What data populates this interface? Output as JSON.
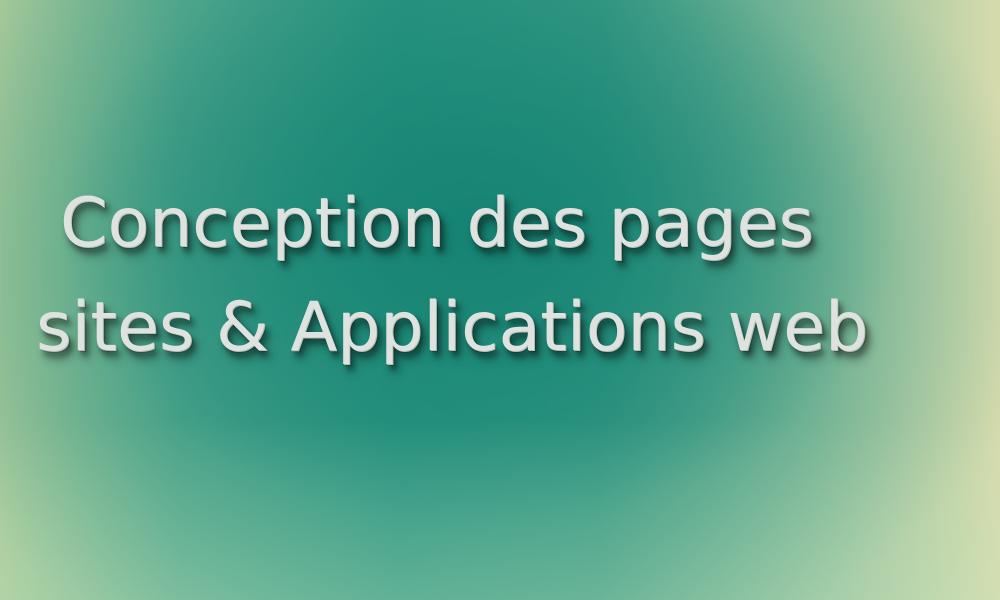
{
  "banner": {
    "line1": "Conception des pages",
    "line2": "sites & Applications web"
  },
  "colors": {
    "center": "#1f8f7d",
    "left_edge": "#a7c99a",
    "right_edge": "#d6dbad",
    "text": "#dfe3e0"
  }
}
